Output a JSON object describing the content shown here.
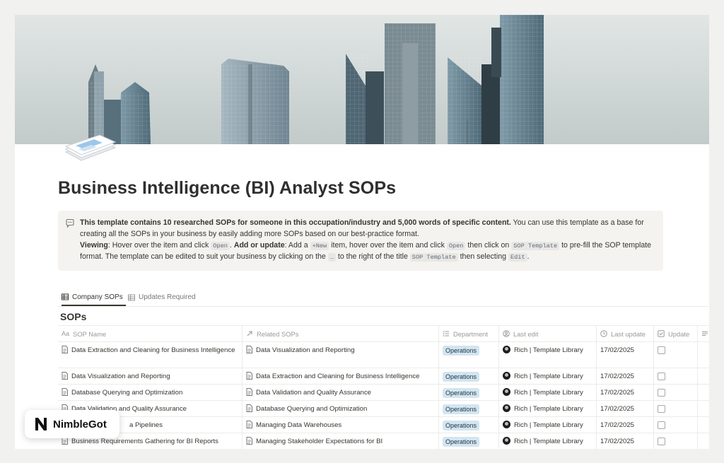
{
  "page": {
    "title": "Business Intelligence (BI) Analyst SOPs"
  },
  "callout": {
    "icon": "speech-bubble-icon",
    "bold_intro": "This template contains 10 researched SOPs for someone in this occupation/industry and 5,000 words of specific content.",
    "intro_rest": " You can use this template as a base for creating all the SOPs in your business by easily adding more SOPs based on our best-practice format.",
    "viewing_label": "Viewing",
    "viewing_text_1": ": Hover over the item and click ",
    "code_open": "Open",
    "viewing_text_2": ". ",
    "add_label": "Add or update",
    "add_text_1": ": Add a ",
    "code_new": "+New",
    "add_text_2": " item, hover over the item and click ",
    "code_open_2": "Open",
    "add_text_3": " then click on ",
    "code_sop_template": "SOP Template",
    "add_text_4": " to pre-fill the SOP template format. The template can be edited to suit your business by clicking on the ",
    "code_dots": "…",
    "add_text_5": " to the right of the title ",
    "code_sop_template_2": "SOP Template",
    "add_text_6": " then selecting ",
    "code_edit": "Edit",
    "add_text_7": "."
  },
  "tabs": [
    {
      "label": "Company SOPs",
      "icon": "table-icon",
      "active": true
    },
    {
      "label": "Updates Required",
      "icon": "table-icon",
      "active": false
    }
  ],
  "database": {
    "title": "SOPs",
    "columns": [
      {
        "label": "SOP Name",
        "icon": "text-Aa-icon"
      },
      {
        "label": "Related SOPs",
        "icon": "relation-arrow-icon"
      },
      {
        "label": "Department",
        "icon": "list-icon"
      },
      {
        "label": "Last edit",
        "icon": "person-icon"
      },
      {
        "label": "Last update",
        "icon": "clock-icon"
      },
      {
        "label": "Update",
        "icon": "checkbox-icon"
      },
      {
        "label": "",
        "icon": "lines-icon"
      }
    ],
    "rows": [
      {
        "name": "Data Extraction and Cleaning for Business Intelligence",
        "related": "Data Visualization and Reporting",
        "department": "Operations",
        "last_edit": "Rich | Template Library",
        "last_update": "17/02/2025"
      },
      {
        "name": "Data Visualization and Reporting",
        "related": "Data Extraction and Cleaning for Business Intelligence",
        "department": "Operations",
        "last_edit": "Rich | Template Library",
        "last_update": "17/02/2025"
      },
      {
        "name": "Database Querying and Optimization",
        "related": "Data Validation and Quality Assurance",
        "department": "Operations",
        "last_edit": "Rich | Template Library",
        "last_update": "17/02/2025"
      },
      {
        "name": "Data Validation and Quality Assurance",
        "related": "Database Querying and Optimization",
        "department": "Operations",
        "last_edit": "Rich | Template Library",
        "last_update": "17/02/2025"
      },
      {
        "name": "a Pipelines",
        "related": "Managing Data Warehouses",
        "department": "Operations",
        "last_edit": "Rich | Template Library",
        "last_update": "17/02/2025"
      },
      {
        "name": "Business Requirements Gathering for BI Reports",
        "related": "Managing Stakeholder Expectations for BI",
        "department": "Operations",
        "last_edit": "Rich | Template Library",
        "last_update": "17/02/2025"
      }
    ]
  },
  "watermark": {
    "brand": "NimbleGot",
    "logo": "N"
  },
  "colors": {
    "tag_bg": "#d3e5ef",
    "tag_text": "#183347",
    "callout_bg": "#f4f3f0"
  }
}
